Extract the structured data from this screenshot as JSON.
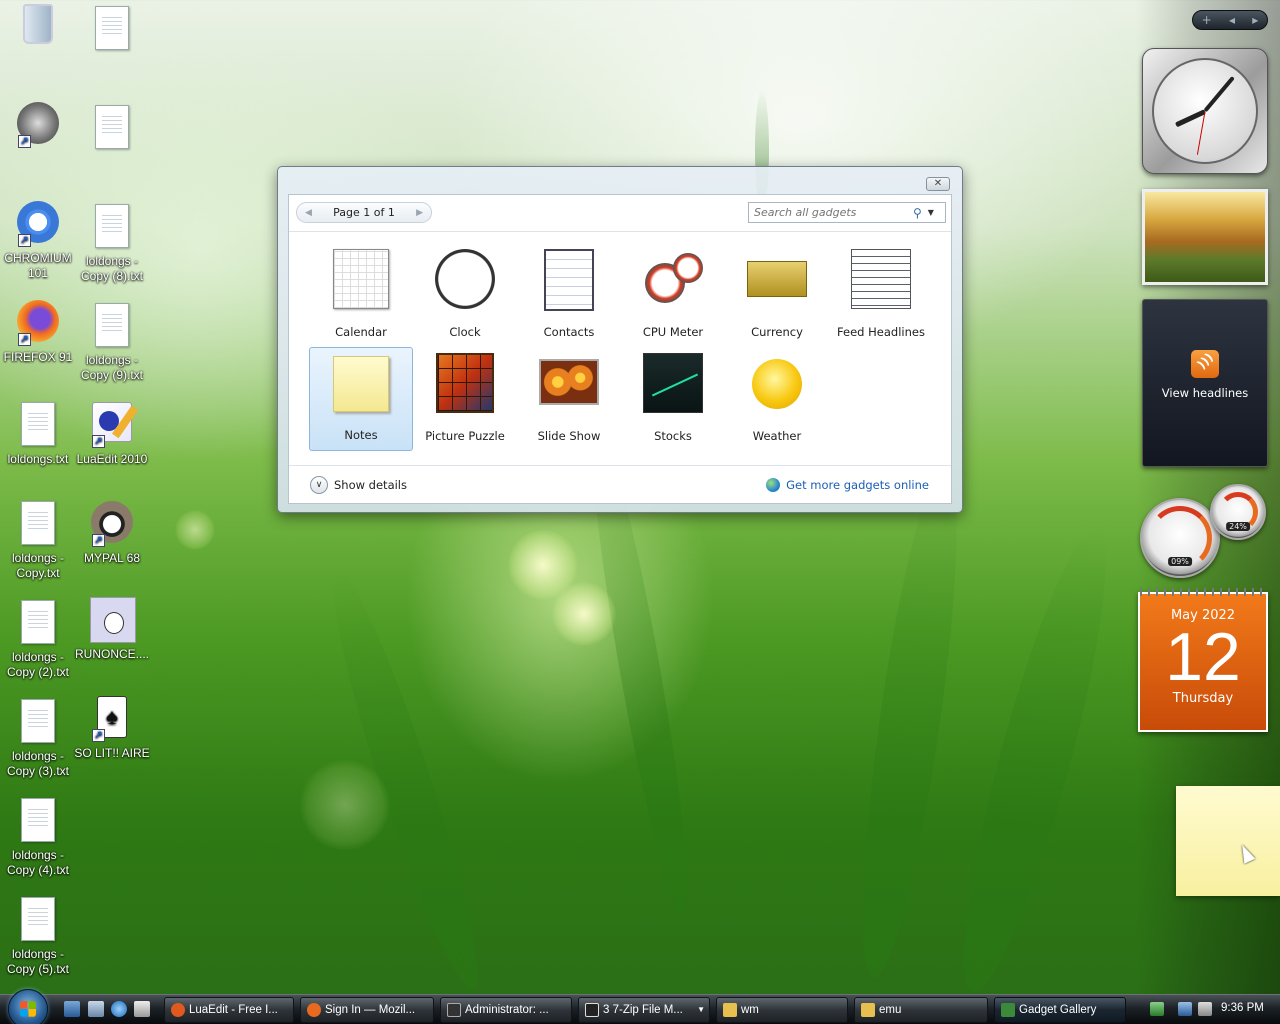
{
  "desktop": {
    "col1": [
      {
        "label": "",
        "icon": "recycle-bin-icon"
      },
      {
        "label": "",
        "icon": "emulator-gear-icon"
      },
      {
        "label": "CHROMIUM 101",
        "icon": "chromium-icon"
      },
      {
        "label": "FIREFOX 91",
        "icon": "firefox-icon"
      },
      {
        "label": "loldongs.txt",
        "icon": "text-file-icon"
      },
      {
        "label": "loldongs - Copy.txt",
        "icon": "text-file-icon"
      },
      {
        "label": "loldongs - Copy (2).txt",
        "icon": "text-file-icon"
      },
      {
        "label": "loldongs - Copy (3).txt",
        "icon": "text-file-icon"
      },
      {
        "label": "loldongs - Copy (4).txt",
        "icon": "text-file-icon"
      },
      {
        "label": "loldongs - Copy (5).txt",
        "icon": "text-file-icon"
      }
    ],
    "col2": [
      {
        "label": "",
        "icon": "text-file-icon"
      },
      {
        "label": "",
        "icon": "text-file-icon"
      },
      {
        "label": "loldongs - Copy (8).txt",
        "icon": "text-file-icon"
      },
      {
        "label": "loldongs - Copy (9).txt",
        "icon": "text-file-icon"
      },
      {
        "label": "LuaEdit 2010",
        "icon": "luaedit-icon"
      },
      {
        "label": "MYPAL 68",
        "icon": "mypal-icon"
      },
      {
        "label": "RUNONCE....",
        "icon": "runonce-icon"
      },
      {
        "label": "SO LIT!! AIRE",
        "icon": "solitaire-icon"
      }
    ]
  },
  "sidebar": {
    "controls": {
      "add": "+",
      "prev": "◂",
      "next": "▸"
    },
    "feed": {
      "text": "View headlines"
    },
    "cpu": {
      "cpu_value": "09%",
      "mem_value": "24%"
    },
    "calendar": {
      "month_year": "May 2022",
      "day": "12",
      "weekday": "Thursday"
    }
  },
  "gallery": {
    "close": "✕",
    "pager": {
      "label": "Page 1 of 1",
      "prev": "◀",
      "next": "▶"
    },
    "search": {
      "placeholder": "Search all gadgets"
    },
    "gadgets": [
      {
        "label": "Calendar",
        "icon": "calendar-gadget-icon"
      },
      {
        "label": "Clock",
        "icon": "clock-gadget-icon"
      },
      {
        "label": "Contacts",
        "icon": "contacts-gadget-icon"
      },
      {
        "label": "CPU Meter",
        "icon": "cpu-meter-gadget-icon"
      },
      {
        "label": "Currency",
        "icon": "currency-gadget-icon"
      },
      {
        "label": "Feed Headlines",
        "icon": "feed-headlines-gadget-icon"
      },
      {
        "label": "Notes",
        "icon": "notes-gadget-icon",
        "selected": true
      },
      {
        "label": "Picture Puzzle",
        "icon": "picture-puzzle-gadget-icon"
      },
      {
        "label": "Slide Show",
        "icon": "slide-show-gadget-icon"
      },
      {
        "label": "Stocks",
        "icon": "stocks-gadget-icon"
      },
      {
        "label": "Weather",
        "icon": "weather-gadget-icon"
      }
    ],
    "show_details": "Show details",
    "more_online": "Get more gadgets online"
  },
  "taskbar": {
    "tasks": [
      {
        "label": "LuaEdit - Free I...",
        "icon": "luaedit-icon",
        "color": "#e05a20"
      },
      {
        "label": "Sign In — Mozil...",
        "icon": "firefox-icon",
        "color": "#e86a20"
      },
      {
        "label": "Administrator: ...",
        "icon": "cmd-icon",
        "color": "#333333"
      },
      {
        "label": "3 7-Zip File M...",
        "icon": "7zip-icon",
        "color": "#222222"
      },
      {
        "label": "wm",
        "icon": "folder-icon",
        "color": "#e8c050"
      },
      {
        "label": "emu",
        "icon": "folder-icon",
        "color": "#e8c050"
      },
      {
        "label": "Gadget Gallery",
        "icon": "gadget-gallery-icon",
        "color": "#3a8a3a"
      }
    ],
    "clock": "9:36 PM"
  },
  "colors": {
    "accent": "#1a5fb4",
    "calendar": "#e8600e"
  }
}
